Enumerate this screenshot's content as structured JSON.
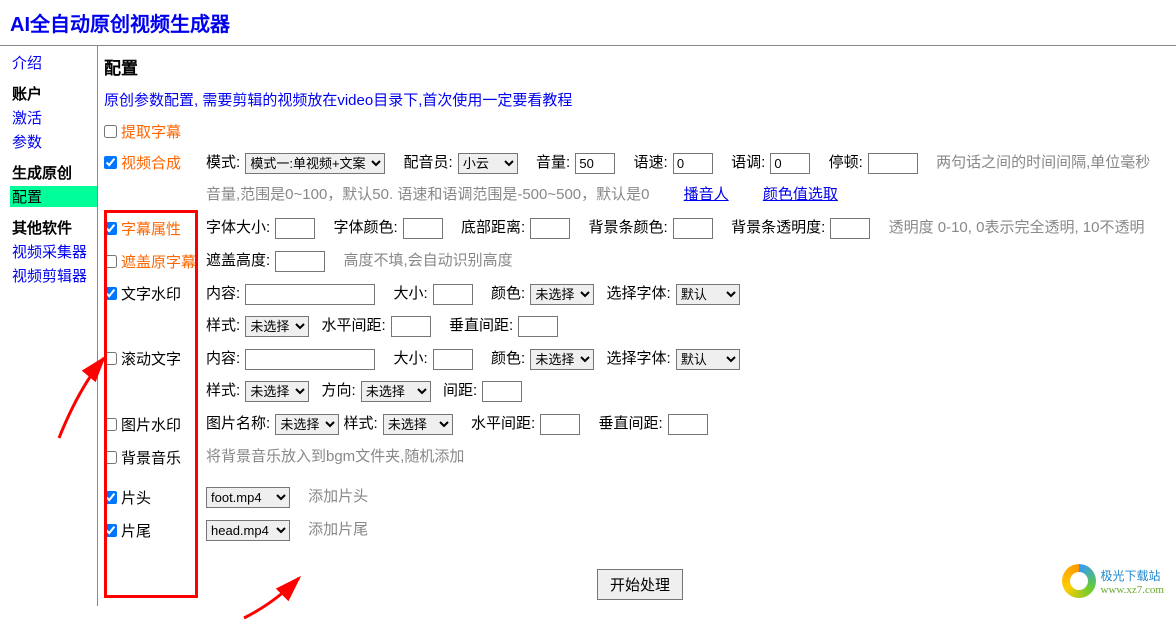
{
  "app_title": "AI全自动原创视频生成器",
  "sidebar": {
    "intro": "介绍",
    "account_head": "账户",
    "activate": "激活",
    "params": "参数",
    "gen_head": "生成原创",
    "config": "配置",
    "other_head": "其他软件",
    "collector": "视频采集器",
    "editor": "视频剪辑器"
  },
  "page_title": "配置",
  "config_desc": "原创参数配置, 需要剪辑的视频放在video目录下,首次使用一定要看教程",
  "rows": {
    "extract": {
      "label": "提取字幕"
    },
    "synth": {
      "label": "视频合成",
      "mode_lbl": "模式:",
      "mode_opt": "模式一:单视频+文案",
      "voice_lbl": "配音员:",
      "voice_opt": "小云",
      "volume_lbl": "音量:",
      "volume_val": "50",
      "speed_lbl": "语速:",
      "speed_val": "0",
      "tone_lbl": "语调:",
      "tone_val": "0",
      "pause_lbl": "停顿:",
      "pause_val": "",
      "pause_hint": "两句话之间的时间间隔,单位毫秒",
      "line2_hint": "音量,范围是0~100，默认50. 语速和语调范围是-500~500，默认是0",
      "broadcaster": "播音人",
      "color_pick": "颜色值选取"
    },
    "subattr": {
      "label": "字幕属性",
      "size_lbl": "字体大小:",
      "color_lbl": "字体颜色:",
      "bottom_lbl": "底部距离:",
      "bgcolor_lbl": "背景条颜色:",
      "bgopacity_lbl": "背景条透明度:",
      "hint": "透明度 0-10, 0表示完全透明, 10不透明"
    },
    "cover": {
      "label": "遮盖原字幕",
      "height_lbl": "遮盖高度:",
      "hint": "高度不填,会自动识别高度"
    },
    "textwm": {
      "label": "文字水印",
      "content_lbl": "内容:",
      "size_lbl": "大小:",
      "color_lbl": "颜色:",
      "color_opt": "未选择",
      "font_lbl": "选择字体:",
      "font_opt": "默认",
      "style_lbl": "样式:",
      "style_opt": "未选择",
      "hgap_lbl": "水平间距:",
      "vgap_lbl": "垂直间距:"
    },
    "scroll": {
      "label": "滚动文字",
      "content_lbl": "内容:",
      "size_lbl": "大小:",
      "color_lbl": "颜色:",
      "color_opt": "未选择",
      "font_lbl": "选择字体:",
      "font_opt": "默认",
      "style_lbl": "样式:",
      "style_opt": "未选择",
      "dir_lbl": "方向:",
      "dir_opt": "未选择",
      "gap_lbl": "间距:"
    },
    "imgwm": {
      "label": "图片水印",
      "name_lbl": "图片名称:",
      "name_opt": "未选择",
      "style_lbl": "样式:",
      "style_opt": "未选择",
      "hgap_lbl": "水平间距:",
      "vgap_lbl": "垂直间距:"
    },
    "bgm": {
      "label": "背景音乐",
      "hint": "将背景音乐放入到bgm文件夹,随机添加"
    },
    "head": {
      "label": "片头",
      "opt": "foot.mp4",
      "hint": "添加片头"
    },
    "foot": {
      "label": "片尾",
      "opt": "head.mp4",
      "hint": "添加片尾"
    }
  },
  "submit": "开始处理",
  "logo": {
    "cn": "极光下载站",
    "en": "www.xz7.com"
  }
}
